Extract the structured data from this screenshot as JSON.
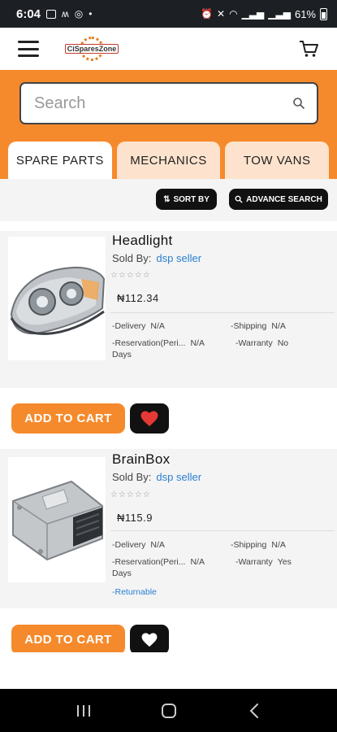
{
  "status_bar": {
    "time": "6:04",
    "battery": "61%"
  },
  "header": {
    "logo_text": "CiSparesZone"
  },
  "search": {
    "placeholder": "Search"
  },
  "tabs": [
    {
      "label": "SPARE PARTS",
      "active": true
    },
    {
      "label": "MECHANICS",
      "active": false
    },
    {
      "label": "TOW VANS",
      "active": false
    }
  ],
  "controls": {
    "sort_label": "SORT BY",
    "advance_label": "ADVANCE SEARCH"
  },
  "products": [
    {
      "title": "Headlight",
      "sold_by_label": "Sold By:",
      "seller": "dsp seller",
      "stars": "☆☆☆☆☆",
      "price": "₦112.34",
      "delivery_label": "-Delivery",
      "delivery_value": "N/A",
      "shipping_label": "-Shipping",
      "shipping_value": "N/A",
      "reservation_label": "-Reservation(Peri...",
      "reservation_value": "N/A",
      "reservation_unit": "Days",
      "warranty_label": "-Warranty",
      "warranty_value": "No",
      "add_to_cart": "ADD TO CART"
    },
    {
      "title": "BrainBox",
      "sold_by_label": "Sold By:",
      "seller": "dsp seller",
      "stars": "☆☆☆☆☆",
      "price": "₦115.9",
      "delivery_label": "-Delivery",
      "delivery_value": "N/A",
      "shipping_label": "-Shipping",
      "shipping_value": "N/A",
      "reservation_label": "-Reservation(Peri...",
      "reservation_value": "N/A",
      "reservation_unit": "Days",
      "warranty_label": "-Warranty",
      "warranty_value": "Yes",
      "returnable": "-Returnable",
      "add_to_cart": "ADD TO CART"
    }
  ],
  "colors": {
    "brand_orange": "#f58a2c",
    "tab_inactive": "#fde3cd",
    "link_blue": "#2a7fd1",
    "heart_red": "#e53935"
  }
}
